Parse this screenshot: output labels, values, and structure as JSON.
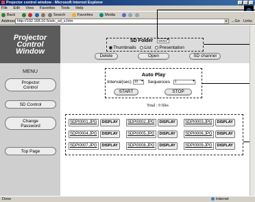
{
  "window": {
    "title": "Projector control window - Microsoft Internet Explorer"
  },
  "menu": [
    "File",
    "Edit",
    "View",
    "Favorites",
    "Tools",
    "Help"
  ],
  "toolbar": {
    "back": "Back",
    "search": "Search",
    "favorites": "Favorites",
    "media": "Media"
  },
  "address": {
    "label": "Address",
    "url": "http://192.168.10.5/sdc_sd_s.htm",
    "go": "Go",
    "links": "Links"
  },
  "logo": {
    "line1": "Projector",
    "line2": "Control",
    "line3": "Window"
  },
  "sd_folder": {
    "label": "SD Folder",
    "selected": "WM01",
    "views": [
      "Thumbnails",
      "List",
      "Presentation"
    ],
    "selected_view": "Thumbnails"
  },
  "actions": {
    "delete": "Delete",
    "open": "Open",
    "sd_channel": "SD channel"
  },
  "sidebar": {
    "title": "MENU",
    "items": [
      "Projector Control",
      "SD Control",
      "Change Password",
      "Top Page"
    ]
  },
  "auto_play": {
    "title": "Auto Play",
    "interval_label": "Interval(sec)",
    "interval_value": "10",
    "sequences_label": "Sequences",
    "sequences_value": "1",
    "start": "START",
    "stop": "STOP"
  },
  "files": {
    "total": "Total : 9 files",
    "display_label": "DISPLAY",
    "names": [
      "SDPI0001.JPG",
      "SDPI0002.JPG",
      "SDPI0003.JPG",
      "SDPI0004.JPG",
      "SDPI0005.JPG",
      "SDPI0006.JPG",
      "SDPI0007.JPG",
      "SDPI0008.JPG",
      "SDPI0009.JPG"
    ]
  },
  "status": {
    "left": "Done",
    "right": "Internet"
  }
}
